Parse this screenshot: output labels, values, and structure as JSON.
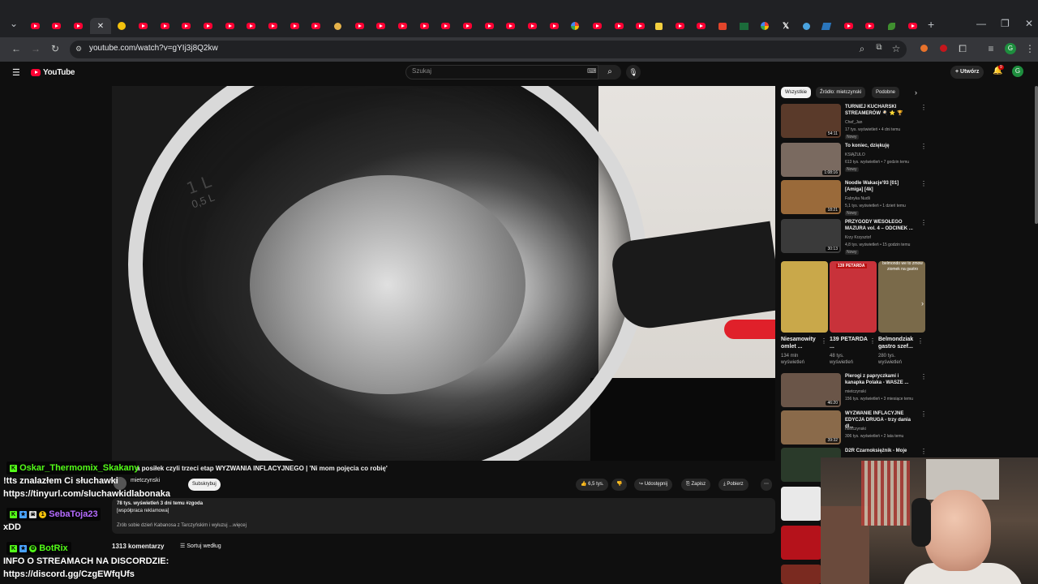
{
  "browser": {
    "url": "youtube.com/watch?v=gYIj3j8Q2kw",
    "profile_initial": "G",
    "tab_buttons": {
      "new_tab": "+",
      "close": "✕",
      "minimize": "—",
      "restore": "❐",
      "window_close": "✕"
    }
  },
  "youtube": {
    "logo_text": "YouTube",
    "search_placeholder": "Szukaj",
    "create_label": "Utwórz",
    "notifications_count": "9",
    "avatar_initial": "G"
  },
  "video": {
    "title": "a posiłek czyli trzeci etap WYZWANIA INFLACYJNEGO | 'Ni mom pojęcia co robię'",
    "channel": "mietczynski",
    "subscribe_label": "Subskrybuj",
    "likes": "6,5 tys.",
    "share_label": "Udostępnij",
    "save_label": "Zapisz",
    "download_label": "Pobierz",
    "description_views": "78 tys. wyświetleń  3 dni temu  #zgoda",
    "description_ad": "[współpraca reklamowa]",
    "description_preview": "Zrób sobie dzień Kabanosa z Tarczyńskim i wyłuzuj ...więcej",
    "comments_count": "1313 komentarzy",
    "sort_label": "Sortuj według",
    "pot_marks": [
      "1 L",
      "0,5 L"
    ]
  },
  "sidebar": {
    "chips": [
      "Wszystkie",
      "Źródło: mietczynski",
      "Podobne"
    ],
    "videos": [
      {
        "title": "TURNIEJ KUCHARSKI STREAMERÓW 🍳 ⭐ 🏆",
        "channel": "Chef_Jan",
        "meta": "17 tys. wyświetleń • 4 dni temu",
        "badge": "Nowy",
        "duration": "54:11",
        "thumb_color": "#5a3a2a"
      },
      {
        "title": "To koniec, dziękuję",
        "channel": "KSIĄŻULO",
        "meta": "613 tys. wyświetleń • 7 godzin temu",
        "badge": "Nowy",
        "duration": "1:08:16",
        "thumb_color": "#7a6a60"
      },
      {
        "title": "Noodle Wakacje'93 [01] [Amiga] [4k]",
        "channel": "Fabryka Nudli",
        "meta": "5,1 tys. wyświetleń • 1 dzień temu",
        "badge": "Nowy",
        "duration": "18:21",
        "thumb_color": "#9a6a3a"
      },
      {
        "title": "PRZYGODY WESOŁEGO MAZURA vol. 4 – ODCINEK ...",
        "channel": "Krzy Krzysztof",
        "meta": "4,8 tys. wyświetleń • 15 godzin temu",
        "badge": "Nowy",
        "duration": "30:13",
        "thumb_color": "#3a3a3a"
      },
      {
        "title": "Pierogi z papryczkami i kanapka Polaka - WASZE ...",
        "channel": "mietczynski",
        "meta": "156 tys. wyświetleń • 3 miesiące temu",
        "badge": "",
        "duration": "46:20",
        "thumb_color": "#6a5548"
      },
      {
        "title": "WYZWANIE INFLACYJNE EDYCJA DRUGA - trzy dania dl...",
        "channel": "mietczynski",
        "meta": "306 tys. wyświetleń • 2 lata temu",
        "badge": "",
        "duration": "39:32",
        "thumb_color": "#8a6a4a"
      },
      {
        "title": "D2R Czarnoksiężnik - Moje",
        "channel": "",
        "meta": "",
        "badge": "",
        "duration": "",
        "thumb_color": "#2a3a2a"
      }
    ],
    "shorts": [
      {
        "title": "Niesamowity omlet ...",
        "meta1": "134 mln",
        "meta2": "wyświetleń",
        "thumb_color": "#c9a84a",
        "overlay": ""
      },
      {
        "title": "139 PETARDA ...",
        "meta1": "48 tys.",
        "meta2": "wyświetleń",
        "thumb_color": "#c8323a",
        "overlay": "139 PETARDA"
      },
      {
        "title": "Belmondziak gastro szef...",
        "meta1": "280 tys.",
        "meta2": "wyświetleń",
        "thumb_color": "#7a6a4a",
        "overlay": "belmondo we to zmow ziomek na gastro"
      }
    ]
  },
  "chat": [
    {
      "user": "Oskar_Thermomix_Skakany",
      "user_color": "#53fc18",
      "message": "!tts znalazłem Ci słuchawki ",
      "message2": "https://tinyurl.com/sluchawkidlabonaka"
    },
    {
      "user": "SebaToja23",
      "user_color": "#b56bff",
      "message": "xDD",
      "message2": ""
    },
    {
      "user": "BotRix",
      "user_color": "#53fc18",
      "message": "INFO O STREAMACH NA DISCORDZIE:",
      "message2": "https://discord.gg/CzgEWfqUfs"
    }
  ]
}
